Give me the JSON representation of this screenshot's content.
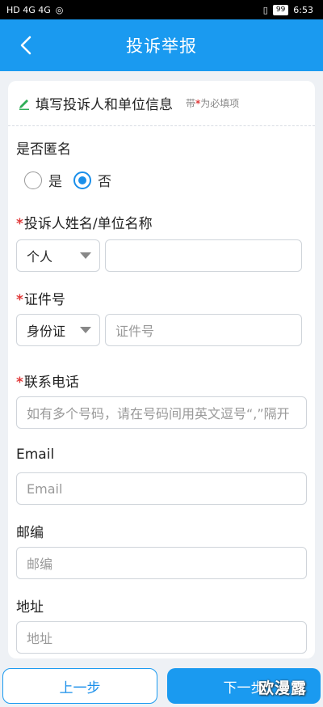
{
  "status_bar": {
    "left": "HD 4G 4G",
    "battery": "99",
    "time": "6:53"
  },
  "header": {
    "title": "投诉举报",
    "back_icon": "chevron-left-icon"
  },
  "section": {
    "title": "填写投诉人和单位信息",
    "required_note_prefix": "带",
    "required_star": "*",
    "required_note_suffix": "为必填项"
  },
  "anonymous": {
    "label": "是否匿名",
    "options": [
      {
        "label": "是",
        "checked": false
      },
      {
        "label": "否",
        "checked": true
      }
    ]
  },
  "complainant": {
    "star": "*",
    "label": "投诉人姓名/单位名称",
    "type_value": "个人",
    "name_value": ""
  },
  "id_number": {
    "star": "*",
    "label": "证件号",
    "type_value": "身份证",
    "placeholder": "证件号"
  },
  "phone": {
    "star": "*",
    "label": "联系电话",
    "placeholder": "如有多个号码，请在号码间用英文逗号“,”隔开"
  },
  "email": {
    "label": "Email",
    "placeholder": "Email"
  },
  "postcode": {
    "label": "邮编",
    "placeholder": "邮编"
  },
  "address": {
    "label": "地址",
    "placeholder": "地址"
  },
  "buttons": {
    "prev": "上一步",
    "next": "下一步"
  },
  "watermark": "欧漫露",
  "colors": {
    "primary": "#1a9af0",
    "required": "#e03a3a",
    "background": "#eef1f5"
  }
}
